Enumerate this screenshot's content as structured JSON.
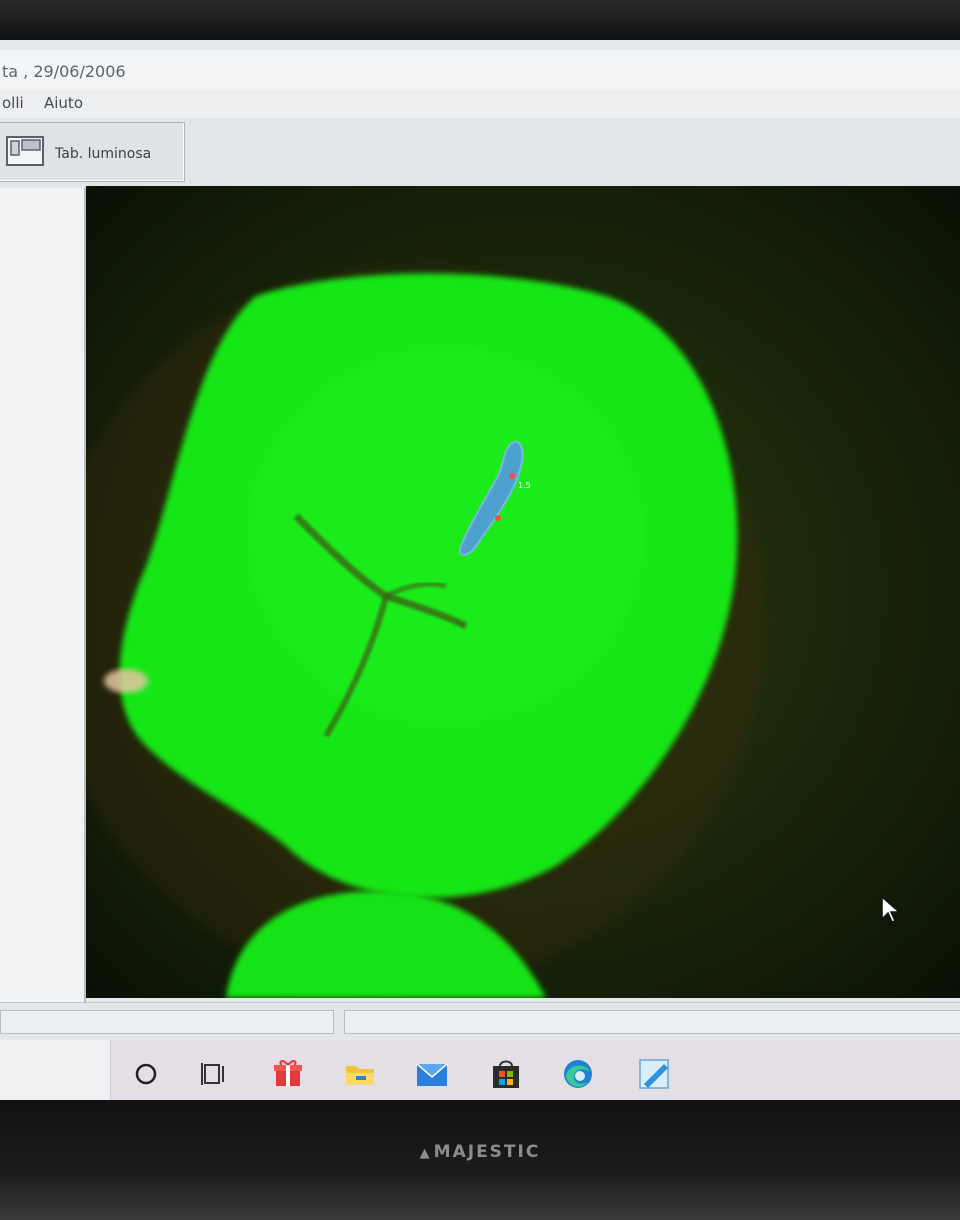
{
  "window": {
    "title": "ta , 29/06/2006"
  },
  "menu": {
    "items": [
      "olli",
      "Aiuto"
    ]
  },
  "toolbar": {
    "button_label": "Tab. luminosa",
    "button_icon": "light-table-icon"
  },
  "taskbar": {
    "icons": [
      {
        "name": "cortana-search-icon"
      },
      {
        "name": "task-view-icon"
      },
      {
        "name": "gift-app-icon"
      },
      {
        "name": "file-explorer-icon"
      },
      {
        "name": "mail-icon"
      },
      {
        "name": "microsoft-store-icon"
      },
      {
        "name": "edge-browser-icon"
      },
      {
        "name": "active-app-icon"
      }
    ]
  },
  "monitor": {
    "brand": "MAJESTIC"
  },
  "image": {
    "subject": "fluorescence image of tooth occlusal surface",
    "colors": {
      "tooth": "#19e619",
      "background": "#0c1507",
      "lesion": "#4f9ed8"
    }
  }
}
